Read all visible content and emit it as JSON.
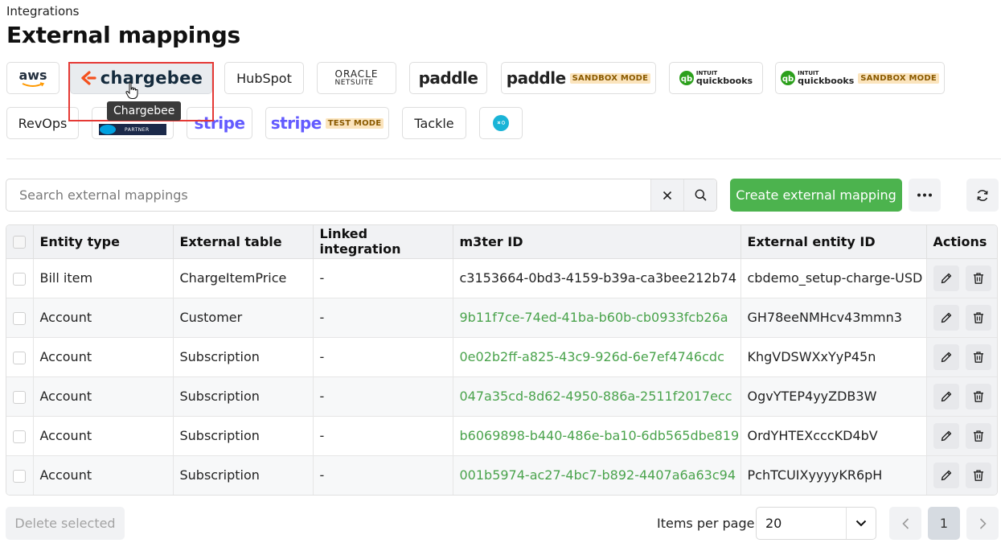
{
  "breadcrumb": "Integrations",
  "title": "External mappings",
  "integrations": {
    "aws": "aws",
    "chargebee": "chargebee",
    "hubspot": "HubSpot",
    "oracle_top": "ORACLE",
    "oracle_bottom": "NETSUITE",
    "paddle": "paddle",
    "paddle_sandbox": "paddle",
    "sandbox_badge": "SANDBOX MODE",
    "qb_top": "INTUIT",
    "qb_bottom": "quickbooks",
    "qb_sandbox_top": "INTUIT",
    "qb_sandbox_bottom": "quickbooks",
    "revops": "RevOps",
    "salesforce_partner": "PARTNER",
    "stripe": "stripe",
    "stripe_test": "stripe",
    "test_badge": "TEST MODE",
    "tackle": "Tackle",
    "tooltip": "Chargebee"
  },
  "search": {
    "placeholder": "Search external mappings"
  },
  "create_button": "Create external mapping",
  "table": {
    "headers": [
      "Entity type",
      "External table",
      "Linked integration",
      "m3ter ID",
      "External entity ID",
      "Actions"
    ],
    "rows": [
      {
        "entity_type": "Bill item",
        "external_table": "ChargeItemPrice",
        "linked_integration": "-",
        "m3ter_id": "c3153664-0bd3-4159-b39a-ca3bee212b74",
        "link": false,
        "external_id": "cbdemo_setup-charge-USD"
      },
      {
        "entity_type": "Account",
        "external_table": "Customer",
        "linked_integration": "-",
        "m3ter_id": "9b11f7ce-74ed-41ba-b60b-cb0933fcb26a",
        "link": true,
        "external_id": "GH78eeNMHcv43mmn3"
      },
      {
        "entity_type": "Account",
        "external_table": "Subscription",
        "linked_integration": "-",
        "m3ter_id": "0e02b2ff-a825-43c9-926d-6e7ef4746cdc",
        "link": true,
        "external_id": "KhgVDSWXxYyP45n"
      },
      {
        "entity_type": "Account",
        "external_table": "Subscription",
        "linked_integration": "-",
        "m3ter_id": "047a35cd-8d62-4950-886a-2511f2017ecc",
        "link": true,
        "external_id": "OgvYTEP4yyZDB3W"
      },
      {
        "entity_type": "Account",
        "external_table": "Subscription",
        "linked_integration": "-",
        "m3ter_id": "b6069898-b440-486e-ba10-6db565dbe819",
        "link": true,
        "external_id": "OrdYHTEXcccKD4bV"
      },
      {
        "entity_type": "Account",
        "external_table": "Subscription",
        "linked_integration": "-",
        "m3ter_id": "001b5974-ac27-4bc7-b892-4407a6a63c94",
        "link": true,
        "external_id": "PchTCUIXyyyyKR6pH"
      }
    ]
  },
  "footer": {
    "delete_selected": "Delete selected",
    "items_per_page_label": "Items per page",
    "items_per_page_value": "20",
    "current_page": "1"
  },
  "colors": {
    "accent": "#4cb34e",
    "highlight": "#e53935",
    "chargebee": "#f4511e",
    "stripe": "#635bff",
    "quickbooks": "#2ca01c",
    "salesforce": "#00a1e0"
  }
}
